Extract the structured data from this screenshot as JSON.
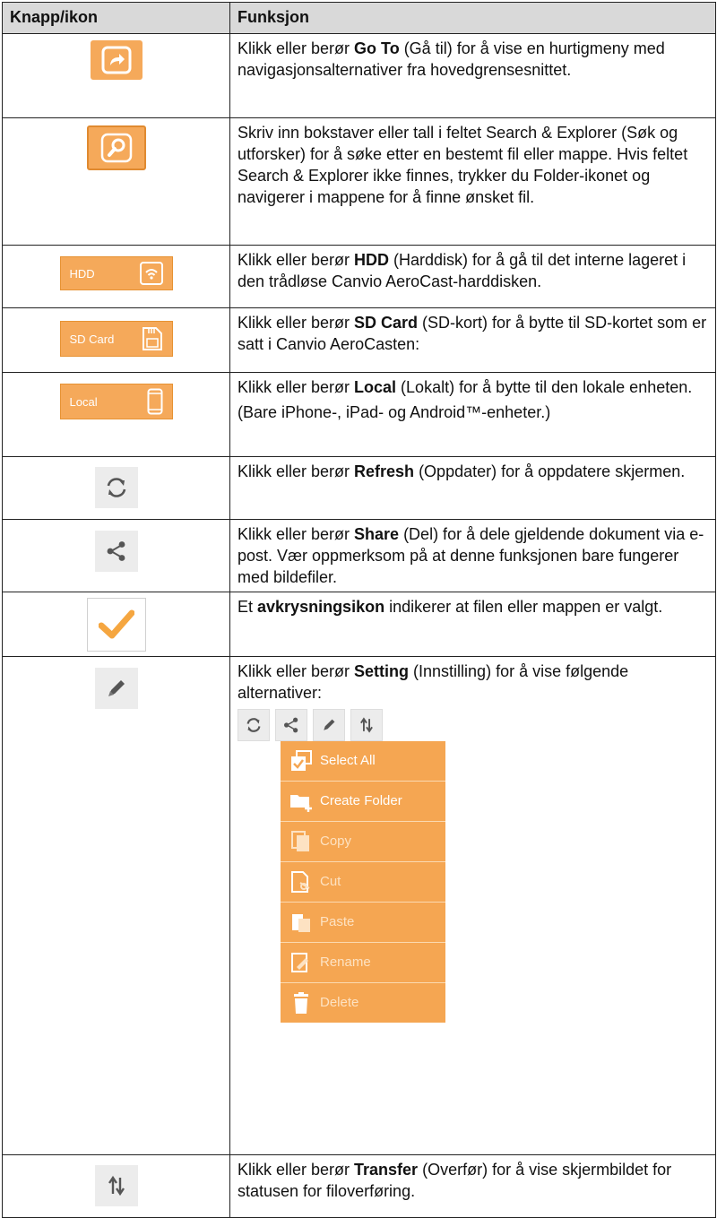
{
  "headers": {
    "col1": "Knapp/ikon",
    "col2": "Funksjon"
  },
  "rows": {
    "goto": {
      "pre": "Klikk eller berør ",
      "bold": "Go To",
      "post": " (Gå til) for å vise en hurtigmeny med navigasjonsalternativer fra hovedgrensesnittet."
    },
    "search": {
      "text": "Skriv inn bokstaver eller tall i feltet Search & Explorer (Søk og utforsker) for å søke etter en bestemt fil eller mappe. Hvis feltet Search & Explorer ikke finnes, trykker du Folder-ikonet og navigerer i mappene for å finne ønsket fil."
    },
    "hdd": {
      "button": "HDD",
      "pre": "Klikk eller berør ",
      "bold": "HDD",
      "post": " (Harddisk) for å gå til det interne lageret i den trådløse Canvio AeroCast-harddisken."
    },
    "sd": {
      "button": "SD Card",
      "pre": "Klikk eller berør ",
      "bold": "SD Card",
      "post": " (SD-kort) for å bytte til SD-kortet som er satt i Canvio AeroCasten:"
    },
    "local": {
      "button": "Local",
      "pre": "Klikk eller berør ",
      "bold": "Local",
      "post": " (Lokalt) for å bytte til den lokale enheten.",
      "note": "(Bare iPhone-, iPad- og Android™-enheter.)"
    },
    "refresh": {
      "pre": "Klikk eller berør ",
      "bold": "Refresh",
      "post": " (Oppdater) for å oppdatere skjermen."
    },
    "share": {
      "pre": "Klikk eller berør ",
      "bold": "Share",
      "post": " (Del) for å dele gjeldende dokument via e-post. Vær oppmerksom på at denne funksjonen bare fungerer med bildefiler."
    },
    "check": {
      "pre": "Et ",
      "bold": "avkrysningsikon",
      "post": " indikerer at filen eller mappen er valgt."
    },
    "setting": {
      "pre": "Klikk eller berør ",
      "bold": "Setting",
      "post": " (Innstilling) for å vise følgende alternativer:"
    },
    "transfer": {
      "pre": "Klikk eller berør ",
      "bold": "Transfer",
      "post": " (Overfør) for å vise skjermbildet for statusen for filoverføring."
    }
  },
  "menu_items": [
    "Select All",
    "Create Folder",
    "Copy",
    "Cut",
    "Paste",
    "Rename",
    "Delete"
  ],
  "colors": {
    "accent": "#f5a95a",
    "header_bg": "#d9d9d9"
  }
}
